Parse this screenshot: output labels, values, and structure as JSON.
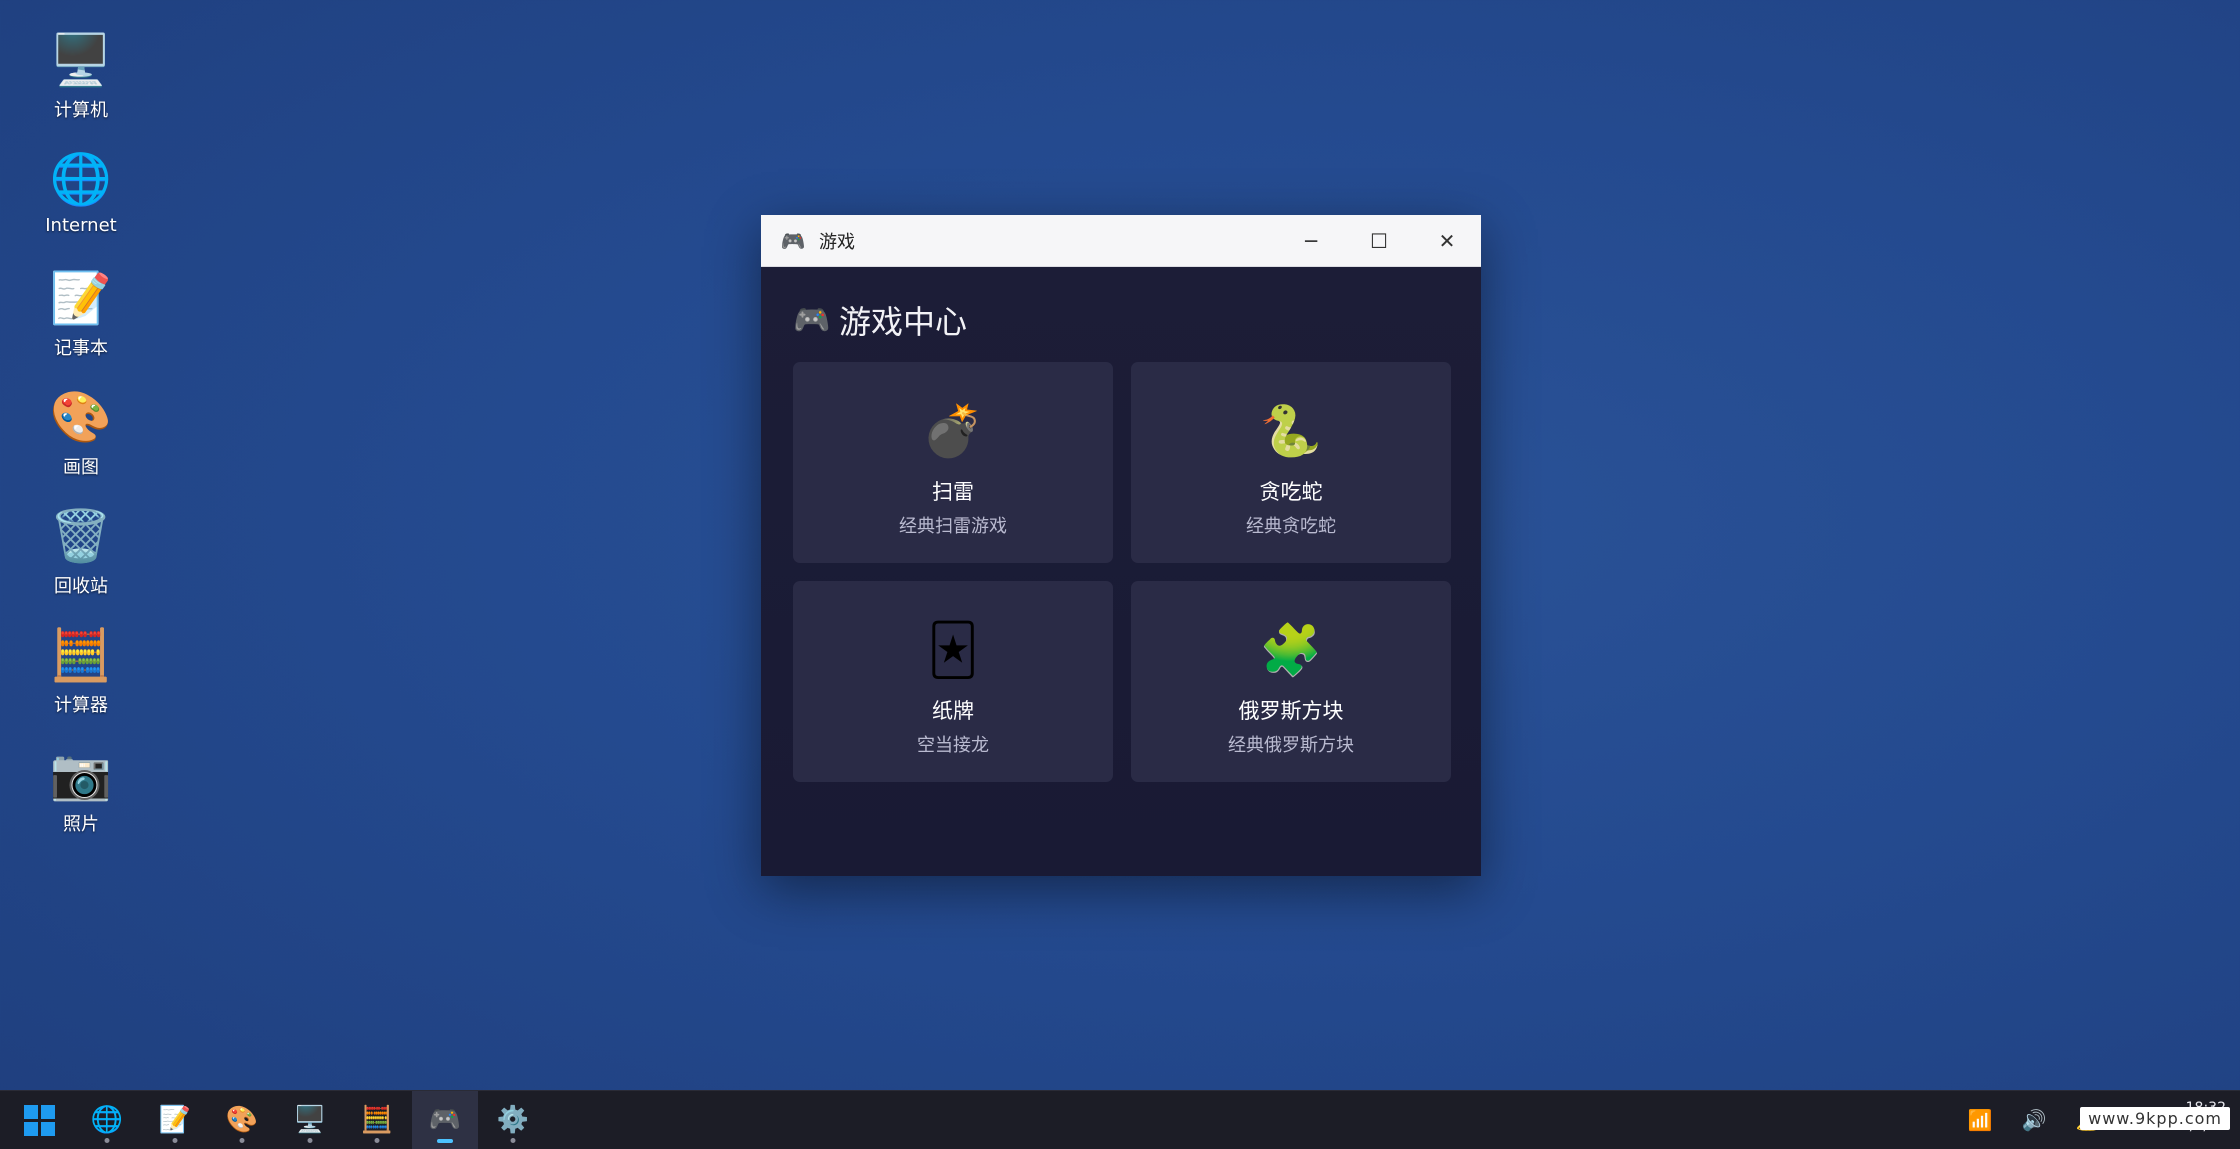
{
  "desktop": {
    "icons": [
      {
        "label": "计算机",
        "icon": "computer-icon",
        "glyph": "🖥️"
      },
      {
        "label": "Internet",
        "icon": "globe-icon",
        "glyph": "🌐"
      },
      {
        "label": "记事本",
        "icon": "notepad-icon",
        "glyph": "📝"
      },
      {
        "label": "画图",
        "icon": "paint-palette-icon",
        "glyph": "🎨"
      },
      {
        "label": "回收站",
        "icon": "recycle-bin-icon",
        "glyph": "🗑️"
      },
      {
        "label": "计算器",
        "icon": "calculator-icon",
        "glyph": "🧮"
      },
      {
        "label": "照片",
        "icon": "camera-icon",
        "glyph": "📷"
      }
    ]
  },
  "window": {
    "title": "游戏",
    "app_icon": "🎮",
    "controls": {
      "minimize": "─",
      "maximize": "☐",
      "close": "✕"
    },
    "header": {
      "icon": "🎮",
      "title": "游戏中心"
    },
    "games": [
      {
        "name": "扫雷",
        "desc": "经典扫雷游戏",
        "icon": "bomb-icon",
        "glyph": "💣"
      },
      {
        "name": "贪吃蛇",
        "desc": "经典贪吃蛇",
        "icon": "snake-icon",
        "glyph": "🐍"
      },
      {
        "name": "纸牌",
        "desc": "空当接龙",
        "icon": "joker-card-icon",
        "glyph": "🃏"
      },
      {
        "name": "俄罗斯方块",
        "desc": "经典俄罗斯方块",
        "icon": "puzzle-piece-icon",
        "glyph": "🧩"
      }
    ]
  },
  "taskbar": {
    "apps": [
      {
        "icon": "globe-icon",
        "glyph": "🌐",
        "active": false
      },
      {
        "icon": "notepad-icon",
        "glyph": "📝",
        "active": false
      },
      {
        "icon": "paint-palette-icon",
        "glyph": "🎨",
        "active": false
      },
      {
        "icon": "computer-icon",
        "glyph": "🖥️",
        "active": false
      },
      {
        "icon": "calculator-icon",
        "glyph": "🧮",
        "active": false
      },
      {
        "icon": "gamepad-icon",
        "glyph": "🎮",
        "active": true
      },
      {
        "icon": "gear-icon",
        "glyph": "⚙️",
        "active": false
      }
    ],
    "tray": {
      "network_glyph": "📶",
      "volume_glyph": "🔊",
      "notification_glyph": "🔔"
    },
    "clock_time": "18:32",
    "clock_date": "2025/6/12",
    "watermark": "www.9kpp.com"
  },
  "colors": {
    "desktop_bg": "#244a8f",
    "window_bg": "#1a1c36",
    "card_bg": "#2a2b46",
    "taskbar_bg": "#1c1d26",
    "active_indicator": "#4cc2ff"
  }
}
